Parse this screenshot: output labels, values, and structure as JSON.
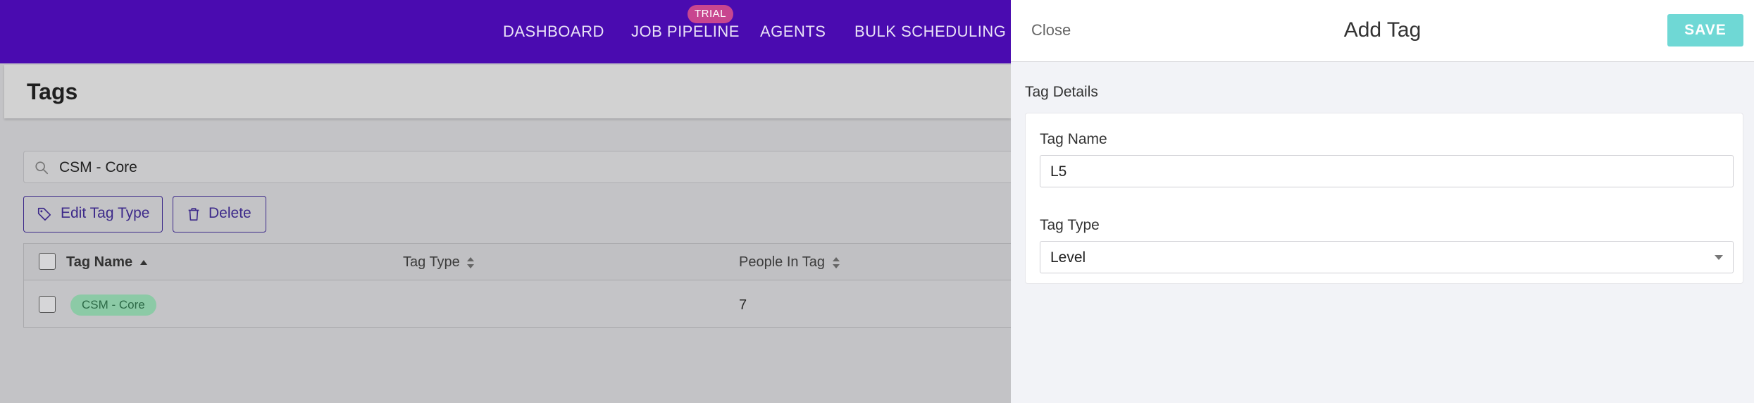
{
  "nav": {
    "items": [
      "DASHBOARD",
      "JOB PIPELINE",
      "AGENTS",
      "BULK SCHEDULING"
    ],
    "trial_badge": "TRIAL"
  },
  "page": {
    "title": "Tags"
  },
  "search": {
    "value": "CSM - Core"
  },
  "actions": {
    "edit_tag_type": "Edit Tag Type",
    "delete": "Delete"
  },
  "table": {
    "headers": {
      "name": "Tag Name",
      "type": "Tag Type",
      "people": "People In Tag"
    },
    "rows": [
      {
        "name": "CSM - Core",
        "type": "",
        "people": "7"
      }
    ]
  },
  "drawer": {
    "close_label": "Close",
    "title": "Add Tag",
    "save_label": "SAVE",
    "section_label": "Tag Details",
    "tag_name_label": "Tag Name",
    "tag_name_value": "L5",
    "tag_type_label": "Tag Type",
    "tag_type_value": "Level"
  },
  "colors": {
    "nav_bg": "#4a0bb0",
    "trial_badge": "#c8468f",
    "save_button": "#6fd8d5",
    "tag_pill": "#8ccaa6",
    "action_outline": "#3d2a8a"
  }
}
